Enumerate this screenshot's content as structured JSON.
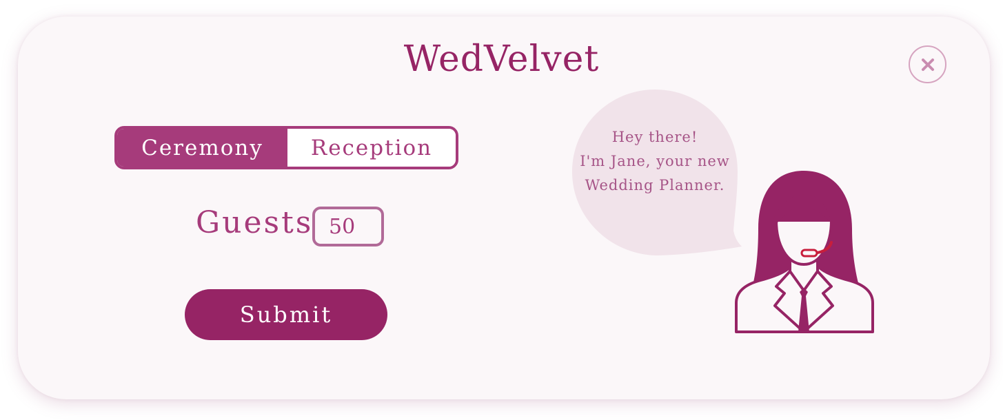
{
  "app": {
    "title": "WedVelvet"
  },
  "toggle": {
    "options": [
      {
        "label": "Ceremony",
        "selected": true
      },
      {
        "label": "Reception",
        "selected": false
      }
    ]
  },
  "guests": {
    "label": "Guests",
    "value": "50"
  },
  "actions": {
    "submit_label": "Submit",
    "close_icon": "close-icon"
  },
  "assistant": {
    "greeting_lines": [
      "Hey there!",
      "I'm Jane, your new",
      "Wedding Planner."
    ],
    "avatar_icon": "planner-headset-icon"
  },
  "colors": {
    "brand": "#962465",
    "accent": "#a63b7b",
    "bubble": "#f1e3ea",
    "background": "#fbf7f9",
    "headset": "#c81e3c"
  }
}
